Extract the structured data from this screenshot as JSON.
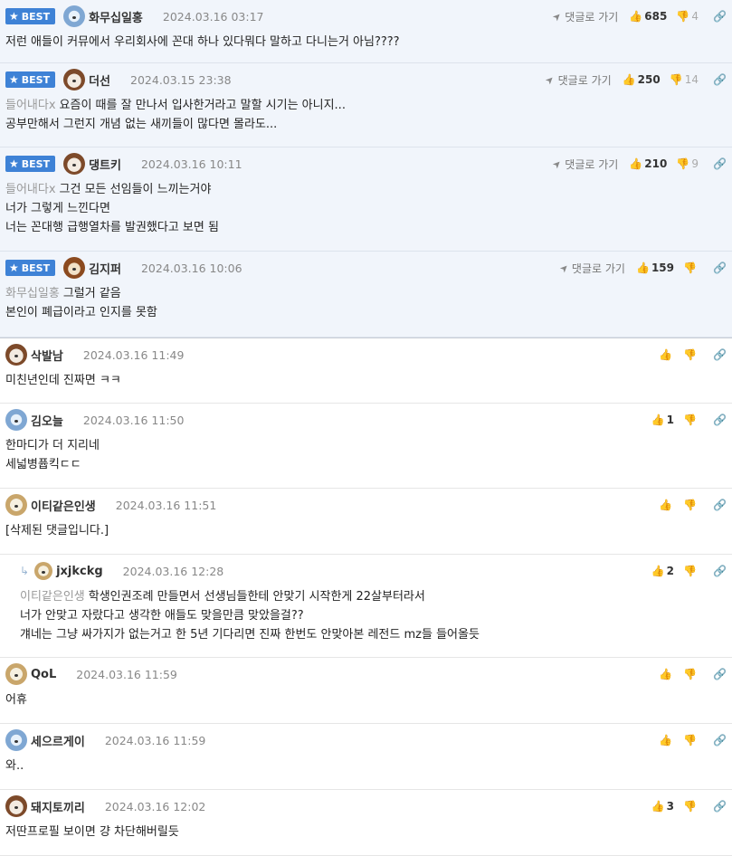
{
  "labels": {
    "best": "BEST",
    "goto": "댓글로 가기"
  },
  "comments": [
    {
      "best": true,
      "author": "화무십일홍",
      "avatar": "ice",
      "time": "2024.03.16 03:17",
      "up": "685",
      "down": "4",
      "lines": [
        {
          "mention": "",
          "text": "저런 애들이 커뮤에서 우리회사에 꼰대 하나 있다뭐다 말하고 다니는거 아님????"
        }
      ]
    },
    {
      "best": true,
      "author": "더선",
      "avatar": "bear",
      "time": "2024.03.15 23:38",
      "up": "250",
      "down": "14",
      "lines": [
        {
          "mention": "들어내다x",
          "text": "요즘이 때를 잘 만나서 입사한거라고 말할 시기는 아니지..."
        },
        {
          "mention": "",
          "text": "공부만해서 그런지 개념 없는 새끼들이 많다면 몰라도..."
        }
      ]
    },
    {
      "best": true,
      "author": "댕트키",
      "avatar": "bear",
      "time": "2024.03.16 10:11",
      "up": "210",
      "down": "9",
      "lines": [
        {
          "mention": "들어내다x",
          "text": "그건 모든 선임들이 느끼는거야"
        },
        {
          "mention": "",
          "text": "너가 그렇게 느낀다면"
        },
        {
          "mention": "",
          "text": "너는 꼰대행 급행열차를 발권했다고 보면 됨"
        }
      ]
    },
    {
      "best": true,
      "author": "김지퍼",
      "avatar": "lion",
      "time": "2024.03.16 10:06",
      "up": "159",
      "down": "",
      "lines": [
        {
          "mention": "화무십일홍",
          "text": "그럴거 같음"
        },
        {
          "mention": "",
          "text": "본인이 폐급이라고 인지를 못함"
        }
      ]
    },
    {
      "best": false,
      "author": "삭발남",
      "avatar": "bear",
      "time": "2024.03.16 11:49",
      "up": "",
      "down": "",
      "lines": [
        {
          "mention": "",
          "text": "미친년인데 진짜면 ㅋㅋ"
        }
      ]
    },
    {
      "best": false,
      "author": "김오늘",
      "avatar": "ice",
      "time": "2024.03.16 11:50",
      "up": "1",
      "down": "",
      "lines": [
        {
          "mention": "",
          "text": "한마디가 더 지리네"
        },
        {
          "mention": "",
          "text": "세넓병퓹킥ㄷㄷ"
        }
      ]
    },
    {
      "best": false,
      "author": "이티같은인생",
      "avatar": "dog",
      "time": "2024.03.16 11:51",
      "up": "",
      "down": "",
      "lines": [
        {
          "mention": "",
          "text": "[삭제된 댓글입니다.]"
        }
      ]
    },
    {
      "best": false,
      "reply": true,
      "author": "jxjkckg",
      "avatar": "dog",
      "time": "2024.03.16 12:28",
      "up": "2",
      "down": "",
      "lines": [
        {
          "mention": "이티같은인생",
          "text": "학생인권조례 만들면서 선생님들한테 안맞기 시작한게 22살부터라서"
        },
        {
          "mention": "",
          "text": "너가 안맞고 자랐다고 생각한 애들도 맞을만큼 맞았을걸??"
        },
        {
          "mention": "",
          "text": "걔네는 그냥 싸가지가 없는거고 한 5년 기다리면 진짜 한번도 안맞아본 레전드 mz들 들어올듯"
        }
      ]
    },
    {
      "best": false,
      "author": "QoL",
      "avatar": "dog",
      "time": "2024.03.16 11:59",
      "up": "",
      "down": "",
      "lines": [
        {
          "mention": "",
          "text": "어휴"
        }
      ]
    },
    {
      "best": false,
      "author": "세으르게이",
      "avatar": "ice",
      "time": "2024.03.16 11:59",
      "up": "",
      "down": "",
      "lines": [
        {
          "mention": "",
          "text": "와.."
        }
      ]
    },
    {
      "best": false,
      "author": "돼지토끼리",
      "avatar": "bear",
      "time": "2024.03.16 12:02",
      "up": "3",
      "down": "",
      "lines": [
        {
          "mention": "",
          "text": "저딴프로필 보이면 걍 차단해버릴듯"
        }
      ]
    }
  ]
}
